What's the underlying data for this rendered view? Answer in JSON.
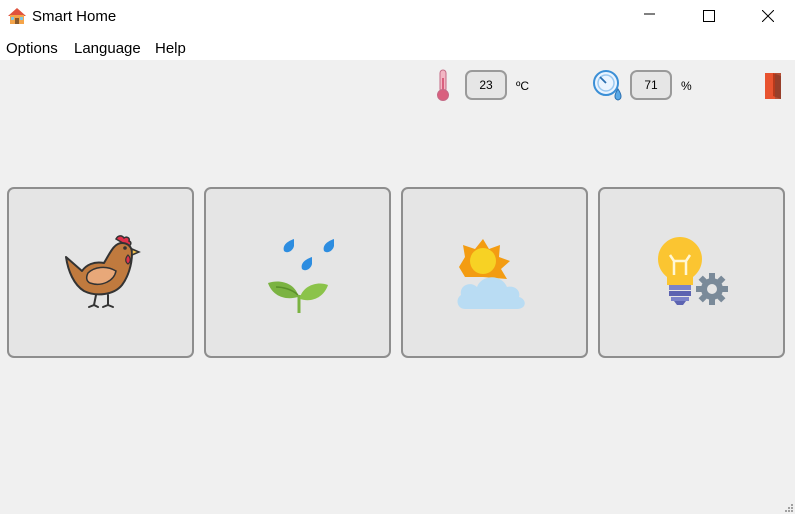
{
  "window": {
    "title": "Smart Home",
    "icon": "house-icon",
    "controls": [
      "minimize-icon",
      "maximize-icon",
      "close-icon"
    ]
  },
  "menu": {
    "items": [
      "Options",
      "Language",
      "Help"
    ]
  },
  "sensors": {
    "temperature": {
      "icon": "thermometer-icon",
      "value": "23",
      "unit": "ºC"
    },
    "humidity": {
      "icon": "humidity-gauge-icon",
      "value": "71",
      "unit": "%"
    }
  },
  "exit_icon": "door-exit-icon",
  "tiles": [
    {
      "name": "tile-chicken",
      "icon": "chicken-icon"
    },
    {
      "name": "tile-irrigation",
      "icon": "plant-watering-icon"
    },
    {
      "name": "tile-weather",
      "icon": "sun-cloud-icon"
    },
    {
      "name": "tile-lighting",
      "icon": "lightbulb-gear-icon"
    }
  ],
  "colors": {
    "background": "#f0f0f0",
    "tile_fill": "#e5e5e5",
    "tile_border": "#8e8e8e",
    "exit_door": "#e8532f"
  }
}
